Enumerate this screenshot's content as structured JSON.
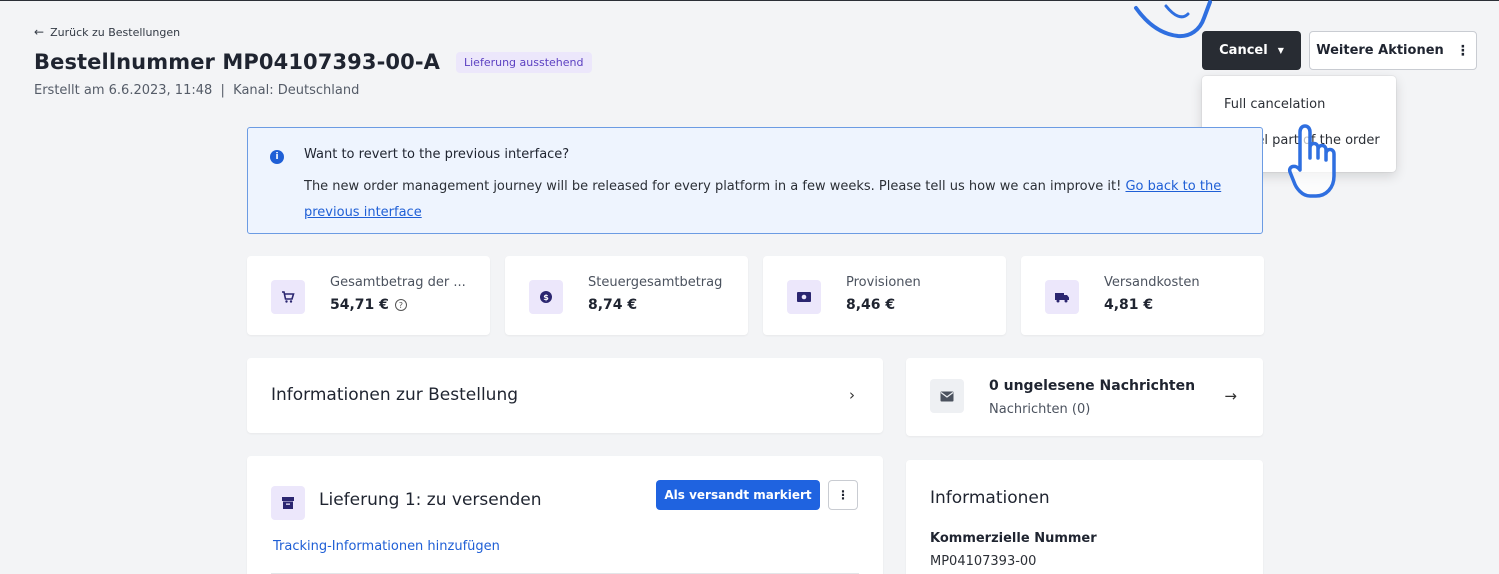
{
  "header": {
    "back_link": "Zurück zu Bestellungen",
    "title": "Bestellnummer MP04107393-00-A",
    "status_badge": "Lieferung ausstehend",
    "meta": "Erstellt am 6.6.2023, 11:48  |  Kanal: Deutschland"
  },
  "actions": {
    "cancel_label": "Cancel",
    "more_label": "Weitere Aktionen"
  },
  "cancel_menu": {
    "items": [
      {
        "label": "Full cancelation"
      },
      {
        "label": "Cancel part of the order"
      }
    ]
  },
  "banner": {
    "title": "Want to revert to the previous interface?",
    "text": "The new order management journey will be released for every platform in a few weeks. Please tell us how we can improve it! ",
    "link": "Go back to the previous interface"
  },
  "kpis": [
    {
      "label": "Gesamtbetrag der ...",
      "value": "54,71 €",
      "icon": "cart-icon"
    },
    {
      "label": "Steuergesamtbetrag",
      "value": "8,74 €",
      "icon": "tax-coin-icon"
    },
    {
      "label": "Provisionen",
      "value": "8,46 €",
      "icon": "money-icon"
    },
    {
      "label": "Versandkosten",
      "value": "4,81 €",
      "icon": "truck-icon"
    }
  ],
  "order_info": {
    "title": "Informationen zur Bestellung"
  },
  "messages": {
    "title": "0 ungelesene Nachrichten",
    "subtitle": "Nachrichten (0)"
  },
  "delivery": {
    "title": "Lieferung 1: zu versenden",
    "mark_shipped_label": "Als versandt markiert",
    "tracking_link": "Tracking-Informationen hinzufügen"
  },
  "informationen": {
    "title": "Informationen",
    "commercial_number_label": "Kommerzielle Nummer",
    "commercial_number_value": "MP04107393-00"
  },
  "colors": {
    "accent": "#1f63e0",
    "dark_button": "#282c33",
    "badge_bg": "#ece7fb",
    "badge_text": "#5b3fc1",
    "banner_border": "#6b9be3"
  }
}
